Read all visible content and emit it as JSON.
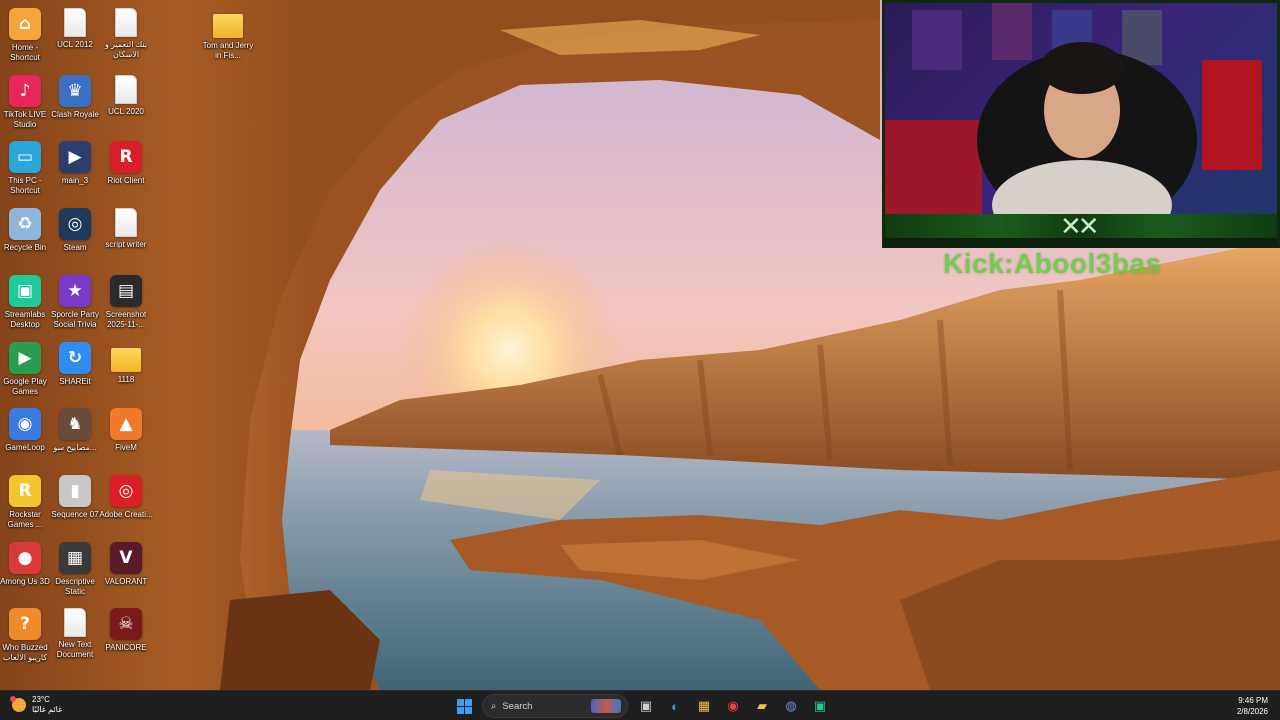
{
  "overlay": {
    "kick_handle": "Kick:Abool3bas"
  },
  "desktop_icons": [
    {
      "id": "home",
      "label": "Home - Shortcut",
      "glyph": "⌂",
      "color": "#f5a43a"
    },
    {
      "id": "ucl2012",
      "label": "UCL 2012",
      "glyph": "",
      "color": "file"
    },
    {
      "id": "arabic-doc",
      "label": "بنك التعمير و الاسكان",
      "glyph": "",
      "color": "file"
    },
    {
      "id": "tom-jerry",
      "label": "Tom and Jerry in Fis...",
      "glyph": "",
      "color": "folder"
    },
    {
      "id": "tiktok",
      "label": "TikTok LIVE Studio",
      "glyph": "♪",
      "color": "#e8265a"
    },
    {
      "id": "clash",
      "label": "Clash Royale",
      "glyph": "♛",
      "color": "#3a6fc4"
    },
    {
      "id": "ucl2020",
      "label": "UCL 2020",
      "glyph": "",
      "color": "file"
    },
    {
      "id": "thispc",
      "label": "This PC - Shortcut",
      "glyph": "▭",
      "color": "#2aa6d8"
    },
    {
      "id": "main3",
      "label": "main_3",
      "glyph": "▶",
      "color": "#2c3e6e"
    },
    {
      "id": "riot",
      "label": "Riot Client",
      "glyph": "R",
      "color": "#d71f2b"
    },
    {
      "id": "recycle",
      "label": "Recycle Bin",
      "glyph": "♻",
      "color": "#8fb6d8"
    },
    {
      "id": "steam",
      "label": "Steam",
      "glyph": "◎",
      "color": "#1b3a5c"
    },
    {
      "id": "script",
      "label": "script writer",
      "glyph": "",
      "color": "file"
    },
    {
      "id": "streamlabs",
      "label": "Streamlabs Desktop",
      "glyph": "▣",
      "color": "#20c99a"
    },
    {
      "id": "sporcle",
      "label": "Sporcle Party Social Trivia",
      "glyph": "★",
      "color": "#7a3ac8"
    },
    {
      "id": "screenshot",
      "label": "Screenshot 2025-11-...",
      "glyph": "▤",
      "color": "#2b2b2b"
    },
    {
      "id": "gplay",
      "label": "Google Play Games",
      "glyph": "▶",
      "color": "#2e9c4f"
    },
    {
      "id": "shareit",
      "label": "SHAREit",
      "glyph": "↻",
      "color": "#2f8cf0"
    },
    {
      "id": "f1118",
      "label": "1118",
      "glyph": "",
      "color": "folder"
    },
    {
      "id": "gameloop",
      "label": "GameLoop",
      "glyph": "◉",
      "color": "#3a7be0"
    },
    {
      "id": "arabic-game",
      "label": "مصابيح سو...",
      "glyph": "♞",
      "color": "#6a4a3a"
    },
    {
      "id": "fivem",
      "label": "FiveM",
      "glyph": "▲",
      "color": "#f07a2a"
    },
    {
      "id": "rockstar",
      "label": "Rockstar Games ...",
      "glyph": "R",
      "color": "#f4c430"
    },
    {
      "id": "seq07",
      "label": "Sequence 07",
      "glyph": "▮",
      "color": "#c8c8c8"
    },
    {
      "id": "adobe",
      "label": "Adobe Creati...",
      "glyph": "◎",
      "color": "#da1f26"
    },
    {
      "id": "amongus",
      "label": "Among Us 3D",
      "glyph": "●",
      "color": "#d83a3a"
    },
    {
      "id": "descstatic",
      "label": "Descriptive Static",
      "glyph": "▦",
      "color": "#3a3a3a"
    },
    {
      "id": "valorant",
      "label": "VALORANT",
      "glyph": "V",
      "color": "#5a1a2a"
    },
    {
      "id": "whobuzzed",
      "label": "Who Buzzed كاريبو الالعاب",
      "glyph": "?",
      "color": "#f08a2a"
    },
    {
      "id": "newtext",
      "label": "New Text Document",
      "glyph": "",
      "color": "file"
    },
    {
      "id": "panicore",
      "label": "PANICORE",
      "glyph": "☠",
      "color": "#7a1a1a"
    }
  ],
  "taskbar": {
    "weather_temp": "23°C",
    "weather_desc": "غائم غالبًا",
    "search_placeholder": "Search",
    "time": "9:46 PM",
    "date": "2/8/2026",
    "apps": [
      {
        "id": "task-view",
        "glyph": "▣",
        "color": "#cfcfcf"
      },
      {
        "id": "edge",
        "glyph": "◐",
        "color": "#2aa6d8"
      },
      {
        "id": "store",
        "glyph": "▦",
        "color": "#f2c14e"
      },
      {
        "id": "chrome",
        "glyph": "◉",
        "color": "#e8453c"
      },
      {
        "id": "file-explorer",
        "glyph": "▰",
        "color": "#f2c14e"
      },
      {
        "id": "discord",
        "glyph": "◍",
        "color": "#7289da"
      },
      {
        "id": "streamlabs",
        "glyph": "▣",
        "color": "#20c99a"
      }
    ]
  }
}
